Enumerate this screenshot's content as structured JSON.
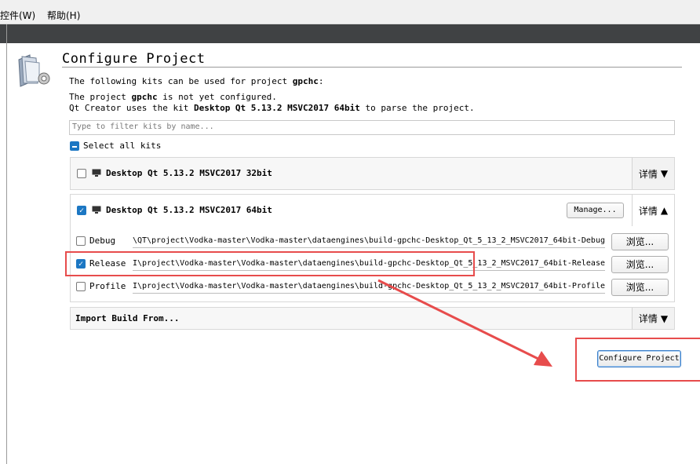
{
  "menubar": {
    "items": [
      "控件(W)",
      "帮助(H)"
    ]
  },
  "page": {
    "title": "Configure Project",
    "intro": "The following kits can be used for project ",
    "project_name": "gpchc",
    "not_configured_a": "The project ",
    "not_configured_b": " is not yet configured.",
    "parse_a": "Qt Creator uses the kit ",
    "parse_kit": "Desktop Qt 5.13.2 MSVC2017 64bit",
    "parse_b": " to parse the project.",
    "filter_placeholder": "Type to filter kits by name...",
    "select_all": "Select all kits"
  },
  "kits": [
    {
      "name": "Desktop Qt 5.13.2 MSVC2017 32bit",
      "checked": false,
      "details": "详情",
      "arrow": "▼"
    },
    {
      "name": "Desktop Qt 5.13.2 MSVC2017 64bit",
      "checked": true,
      "details": "详情",
      "arrow": "▲",
      "manage": "Manage..."
    }
  ],
  "builds": [
    {
      "label": "Debug",
      "checked": false,
      "path": "\\QT\\project\\Vodka-master\\Vodka-master\\dataengines\\build-gpchc-Desktop_Qt_5_13_2_MSVC2017_64bit-Debug",
      "browse": "浏览..."
    },
    {
      "label": "Release",
      "checked": true,
      "path": "I\\project\\Vodka-master\\Vodka-master\\dataengines\\build-gpchc-Desktop_Qt_5_13_2_MSVC2017_64bit-Release",
      "browse": "浏览..."
    },
    {
      "label": "Profile",
      "checked": false,
      "path": "I\\project\\Vodka-master\\Vodka-master\\dataengines\\build-gpchc-Desktop_Qt_5_13_2_MSVC2017_64bit-Profile",
      "browse": "浏览..."
    }
  ],
  "import_build": {
    "label": "Import Build From...",
    "details": "详情",
    "arrow": "▼"
  },
  "configure_button": "Configure Project",
  "colors": {
    "accent": "#1c77c3",
    "annotation": "#e74c4c",
    "toolbar": "#404244"
  }
}
